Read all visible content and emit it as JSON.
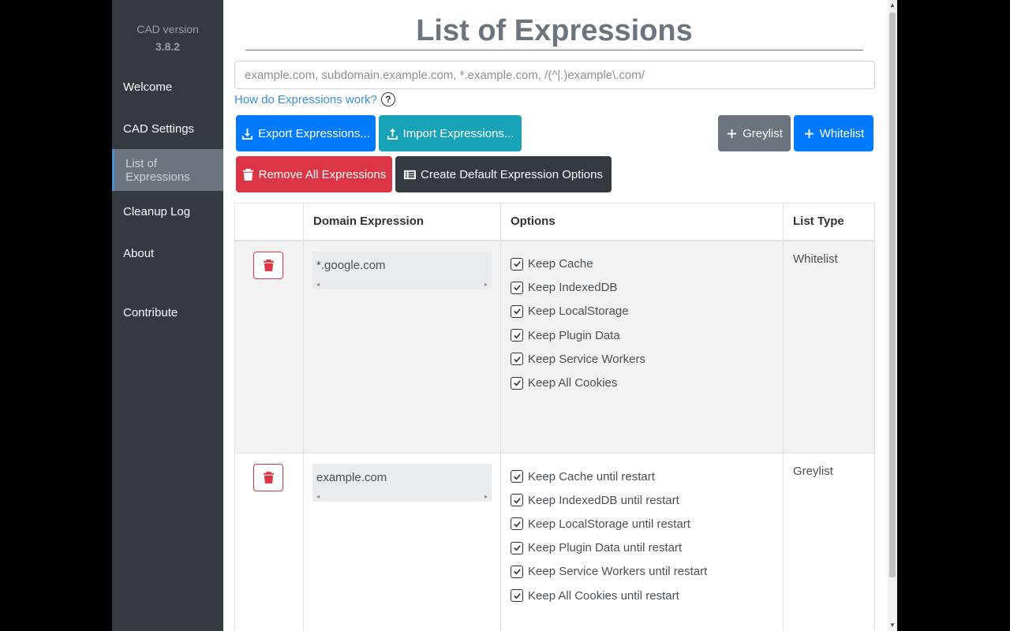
{
  "sidebar": {
    "version_label": "CAD version",
    "version_number": "3.8.2",
    "items": [
      {
        "label": "Welcome"
      },
      {
        "label": "CAD Settings"
      },
      {
        "label": "List of Expressions"
      },
      {
        "label": "Cleanup Log"
      },
      {
        "label": "About"
      },
      {
        "label": "Contribute"
      }
    ]
  },
  "main": {
    "title": "List of Expressions",
    "input_placeholder": "example.com, subdomain.example.com, *.example.com, /(^|.)example\\.com/",
    "help_link": "How do Expressions work?",
    "buttons": {
      "export": "Export Expressions...",
      "import": "Import Expressions...",
      "greylist": "Greylist",
      "whitelist": "Whitelist",
      "remove_all": "Remove All Expressions",
      "create_default": "Create Default Expression Options"
    },
    "table": {
      "headers": [
        "",
        "Domain Expression",
        "Options",
        "List Type"
      ],
      "rows": [
        {
          "domain": "*.google.com",
          "options": [
            "Keep Cache",
            "Keep IndexedDB",
            "Keep LocalStorage",
            "Keep Plugin Data",
            "Keep Service Workers",
            "Keep All Cookies"
          ],
          "list_type": "Whitelist"
        },
        {
          "domain": "example.com",
          "options": [
            "Keep Cache until restart",
            "Keep IndexedDB until restart",
            "Keep LocalStorage until restart",
            "Keep Plugin Data until restart",
            "Keep Service Workers until restart",
            "Keep All Cookies until restart"
          ],
          "list_type": "Greylist"
        }
      ]
    }
  },
  "colors": {
    "sidebar_bg": "#343a40",
    "primary": "#007bff",
    "info": "#17a2b8",
    "secondary": "#6c757d",
    "danger": "#dc3545",
    "dark": "#343a40"
  }
}
